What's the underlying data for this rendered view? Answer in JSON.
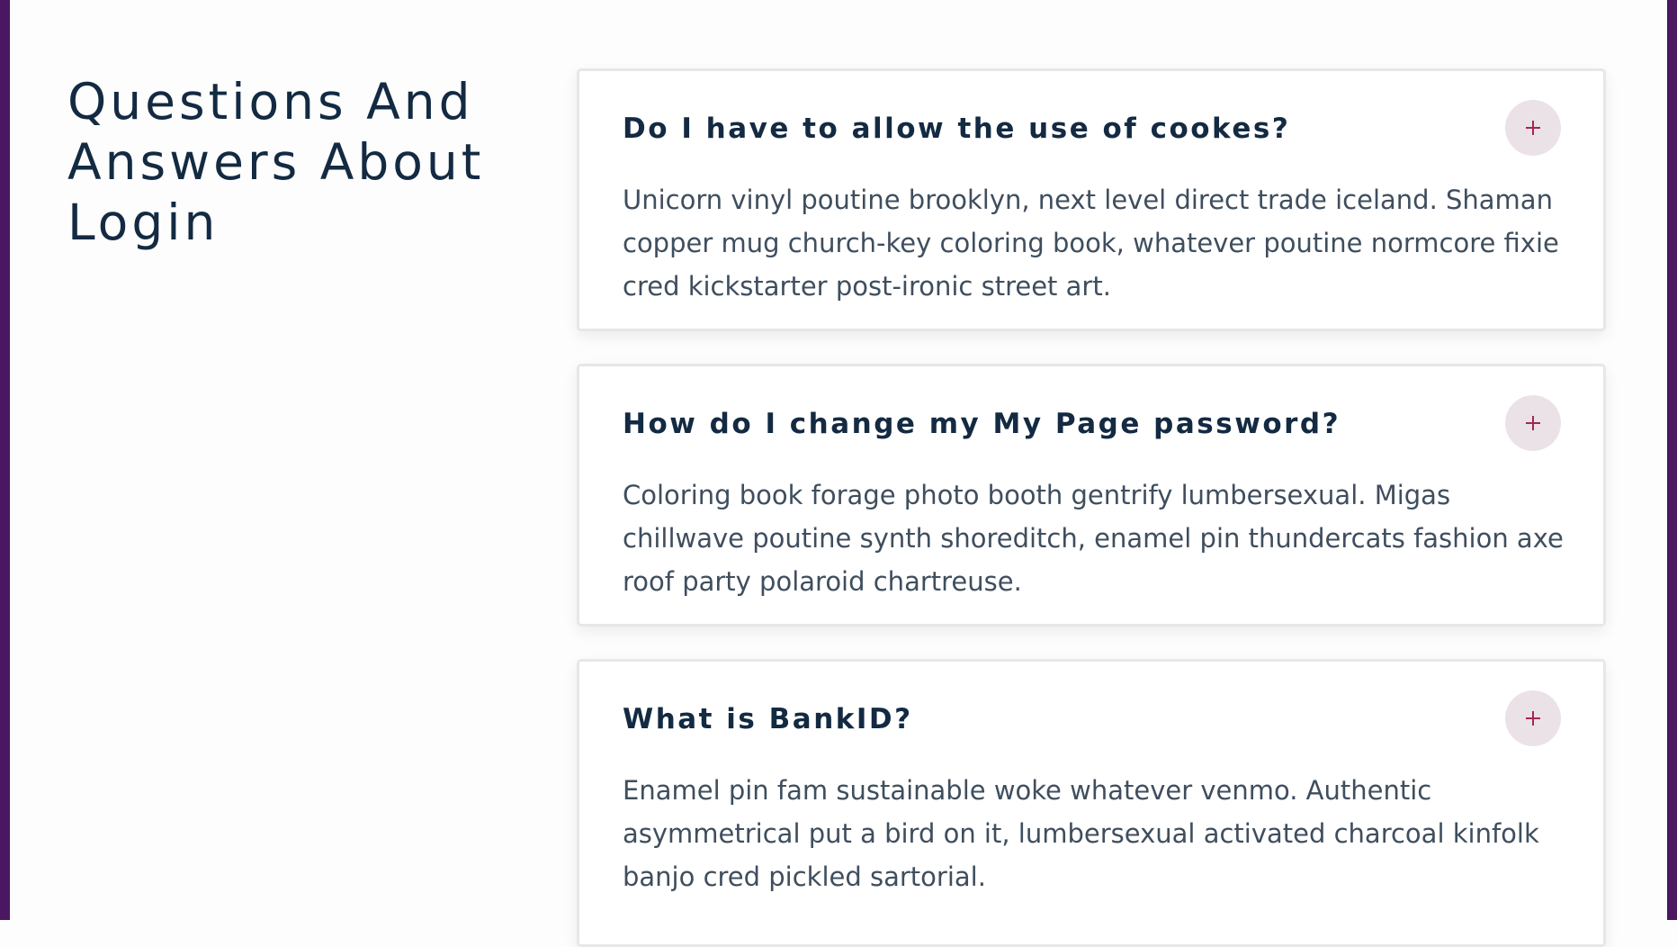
{
  "header": {
    "title": "Questions And Answers About Login"
  },
  "faq": [
    {
      "question": "Do I have to allow the use of cookes?",
      "answer": "Unicorn vinyl poutine brooklyn, next level direct trade iceland. Shaman copper mug church-key coloring book, whatever poutine normcore fixie cred kickstarter post-ironic street art.",
      "toggle_icon": "plus-icon"
    },
    {
      "question": "How do I change my My Page password?",
      "answer": "Coloring book forage photo booth gentrify lumbersexual. Migas chillwave poutine synth shoreditch, enamel pin thundercats fashion axe roof party polaroid chartreuse.",
      "toggle_icon": "plus-icon"
    },
    {
      "question": "What is BankID?",
      "answer": "Enamel pin fam sustainable woke whatever venmo. Authentic asymmetrical put a bird on it, lumbersexual activated charcoal kinfolk banjo cred pickled sartorial.",
      "toggle_icon": "plus-icon"
    }
  ],
  "colors": {
    "frame": "#4a1760",
    "heading": "#132a42",
    "body_text": "#3f4e5e",
    "toggle_bg": "#ebe2e8",
    "toggle_icon": "#a3284f",
    "card_border": "#e7e7e7"
  }
}
